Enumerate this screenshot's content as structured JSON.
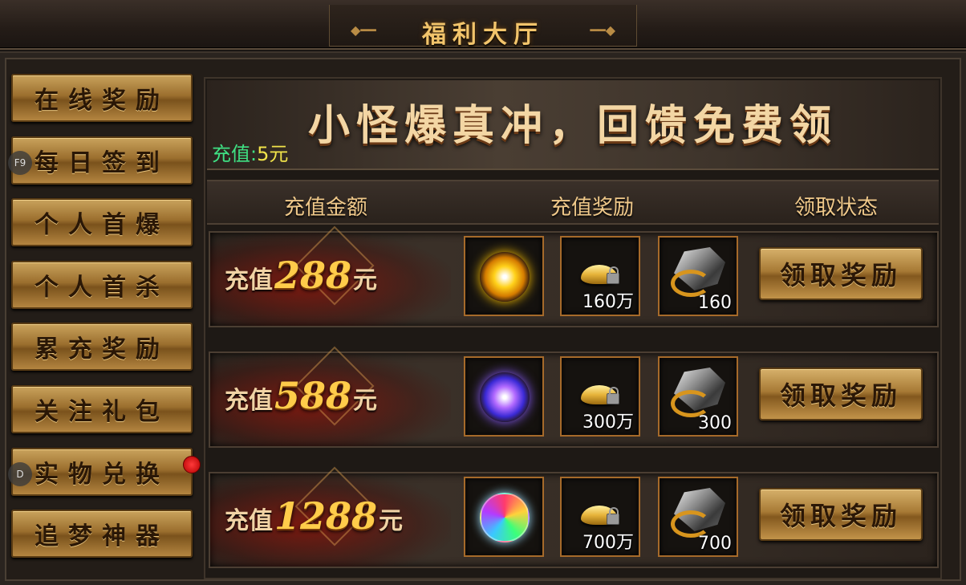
{
  "window": {
    "title": "福利大厅"
  },
  "sidebar": {
    "items": [
      {
        "label": "在线奖励"
      },
      {
        "label": "每日签到",
        "hotkey": "F9"
      },
      {
        "label": "个人首爆"
      },
      {
        "label": "个人首杀"
      },
      {
        "label": "累充奖励"
      },
      {
        "label": "关注礼包"
      },
      {
        "label": "实物兑换",
        "hotkey": "D",
        "has_notification": true
      },
      {
        "label": "追梦神器"
      }
    ]
  },
  "banner": {
    "slogan": "小怪爆真冲，回馈免费领",
    "recharge_label": "充值:",
    "recharge_value": "5元"
  },
  "table": {
    "headers": [
      "充值金额",
      "充值奖励",
      "领取状态"
    ],
    "rows": [
      {
        "prefix": "充值",
        "amount": "288",
        "suffix": "元",
        "orb": "yellow-orb-icon",
        "gold_count": "160万",
        "stone_count": "160",
        "button": "领取奖励"
      },
      {
        "prefix": "充值",
        "amount": "588",
        "suffix": "元",
        "orb": "purple-orb-icon",
        "gold_count": "300万",
        "stone_count": "300",
        "button": "领取奖励"
      },
      {
        "prefix": "充值",
        "amount": "1288",
        "suffix": "元",
        "orb": "rainbow-orb-icon",
        "gold_count": "700万",
        "stone_count": "700",
        "button": "领取奖励"
      }
    ]
  },
  "colors": {
    "gold_text": "#f2c46b",
    "recharge_label": "#3fe083",
    "recharge_value": "#f1e34a",
    "notification": "#e01010"
  }
}
